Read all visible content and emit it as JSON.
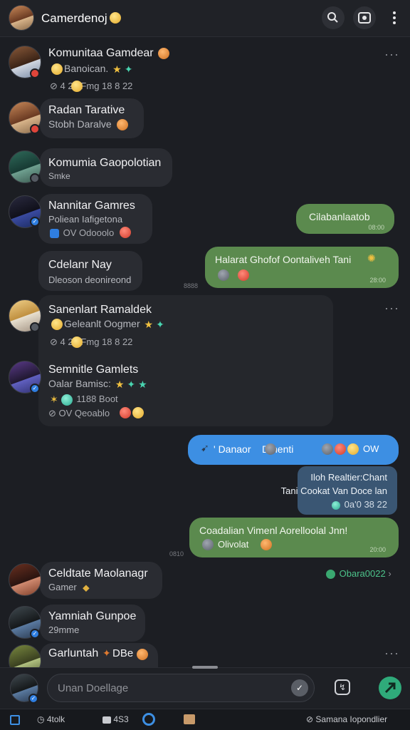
{
  "header": {
    "title": "Camerdenoj",
    "icons": [
      "search-icon",
      "media-icon",
      "more-vert-icon"
    ]
  },
  "chats": [
    {
      "name": "Komunitaa Gamdear",
      "preview": "Banoican.",
      "meta": "4  24 Fmg 18 8 22"
    },
    {
      "name": "Radan Tarative",
      "preview": "Stobh Daralve"
    },
    {
      "name": "Komumia Gaopolotian",
      "preview": "Smke"
    },
    {
      "name": "Nannitar Gamres",
      "preview": "Poliean Iafigetona",
      "meta": "OV  Odooolo"
    },
    {
      "name": "Cdelanr Nay",
      "preview": "Dleoson deonireond",
      "time": "8888"
    },
    {
      "name": "Sanenlart Ramaldek",
      "preview": "Geleanlt Oogmer",
      "meta": "4  24 Fmg 18 8 22"
    },
    {
      "name": "Semnitle Gamlets",
      "preview": "Oalar Bamisc:",
      "meta2": "1188 Boot",
      "meta": "OV  Qeoablo"
    },
    {
      "name": "Celdtate Maolanagr",
      "preview": "Gamer",
      "status": "Obara0022"
    },
    {
      "name": "Yamniah Gunpoe",
      "preview": "29mme"
    },
    {
      "name": "Garluntah",
      "preview": "DBe"
    }
  ],
  "messages": [
    {
      "text": "Cilabanlaatob",
      "time": "08:00"
    },
    {
      "text": "Halarat Ghofof Oontaliveh Tani",
      "time": "28:00"
    },
    {
      "text": "' Danaor    Dmenti",
      "tail": "OW"
    },
    {
      "text1": "Iloh Realtier:Chant",
      "text2": "Tani Cookat Van Doce lan",
      "meta": "0a'0  38 22"
    },
    {
      "text1": "Coadalian Vimenl Aorelloolal Jnn!",
      "text2": "Olivolat",
      "time": "20:00",
      "side_time": "0810"
    }
  ],
  "composer": {
    "placeholder": "Unan Doellage"
  },
  "taskbar": {
    "item1": "4tolk",
    "item2": "4S3",
    "right_label": "Samana Iopondlier"
  },
  "colors": {
    "accent_green": "#5b8a4e",
    "accent_blue": "#3d8fe3",
    "background": "#1c1e23"
  }
}
